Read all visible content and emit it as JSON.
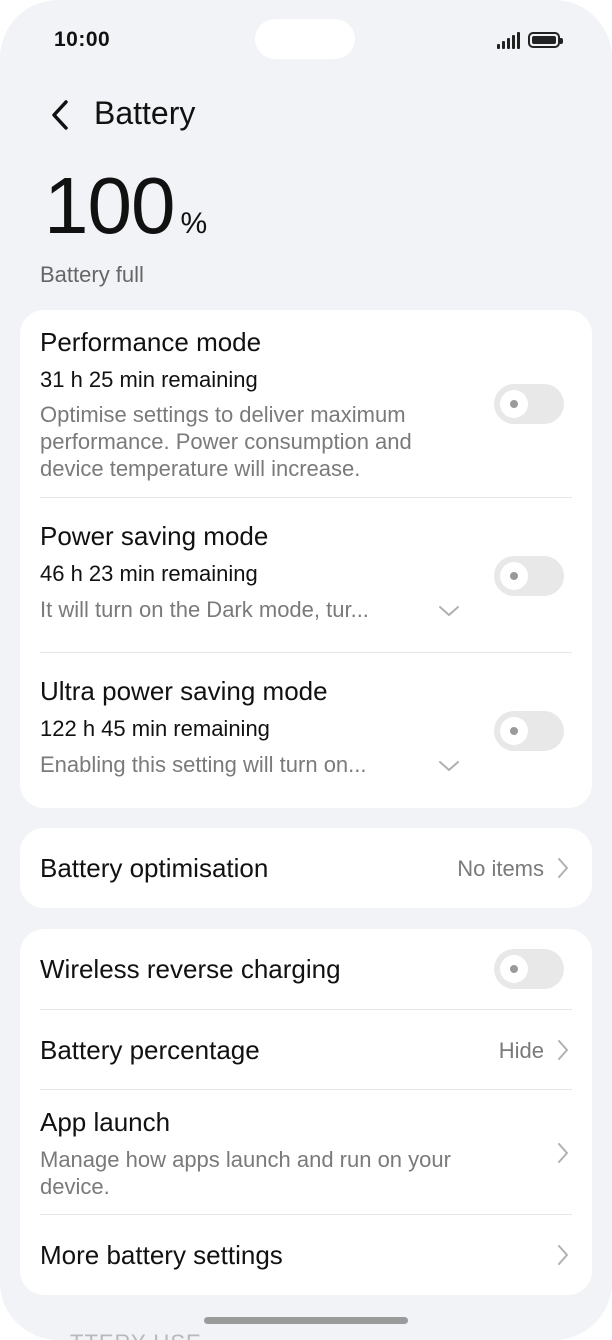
{
  "status_bar": {
    "time": "10:00"
  },
  "header": {
    "title": "Battery"
  },
  "battery": {
    "percent": "100",
    "percent_symbol": "%",
    "status": "Battery full"
  },
  "modes": [
    {
      "title": "Performance mode",
      "remaining": "31 h 25 min remaining",
      "description": "Optimise settings to deliver maximum performance. Power consumption and device temperature will increase.",
      "enabled": false
    },
    {
      "title": "Power saving mode",
      "remaining": "46 h 23 min remaining",
      "description": "It will turn on the Dark mode, tur...",
      "enabled": false
    },
    {
      "title": "Ultra power saving mode",
      "remaining": "122 h 45 min remaining",
      "description": "Enabling this setting will turn on...",
      "enabled": false
    }
  ],
  "optimisation": {
    "label": "Battery optimisation",
    "value": "No items"
  },
  "settings": {
    "wireless_reverse": {
      "label": "Wireless reverse charging",
      "enabled": false
    },
    "battery_percentage": {
      "label": "Battery percentage",
      "value": "Hide"
    },
    "app_launch": {
      "label": "App launch",
      "description": "Manage how apps launch and run on your device."
    },
    "more": {
      "label": "More battery settings"
    }
  },
  "footer": {
    "partial_text": "TTERY USE"
  }
}
